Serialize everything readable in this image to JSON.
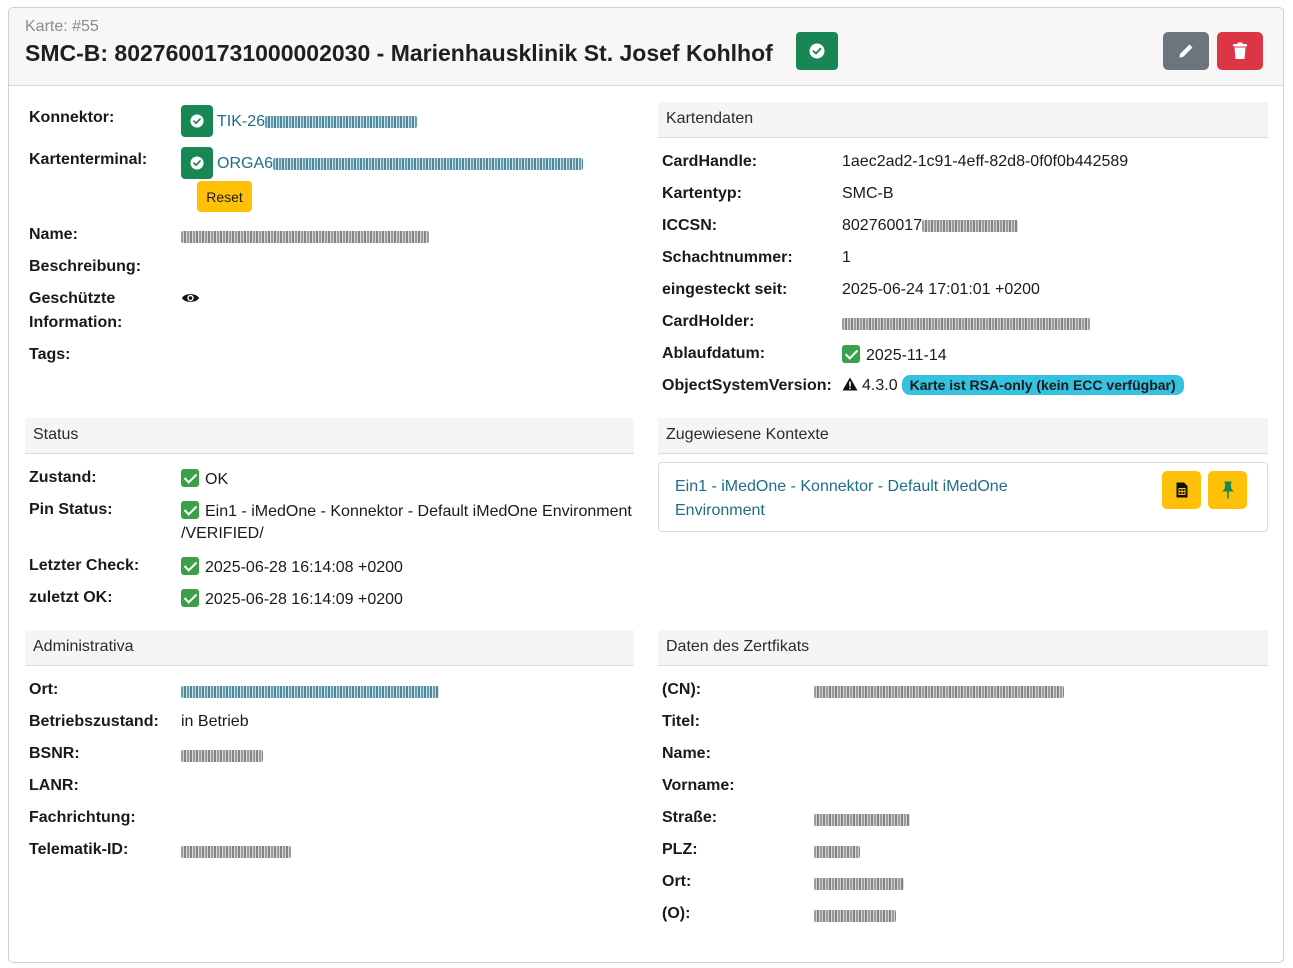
{
  "header": {
    "subtitle": "Karte: #55",
    "title": "SMC-B: 80276001731000002030 - Marienhausklinik St. Josef Kohlhof",
    "status_icon": "check-circle-icon",
    "edit_icon": "pencil-icon",
    "delete_icon": "trash-icon"
  },
  "left": {
    "konnektor_label": "Konnektor:",
    "konnektor_value": "TIK-26",
    "kartenterminal_label": "Kartenterminal:",
    "kartenterminal_value": "ORGA6",
    "reset_label": "Reset",
    "name_label": "Name:",
    "beschreibung_label": "Beschreibung:",
    "geschuetzte_label_1": "Geschützte",
    "geschuetzte_label_2": "Information:",
    "tags_label": "Tags:"
  },
  "kartendaten": {
    "heading": "Kartendaten",
    "rows": [
      {
        "label": "CardHandle:",
        "value": "1aec2ad2-1c91-4eff-82d8-0f0f0b442589"
      },
      {
        "label": "Kartentyp:",
        "value": "SMC-B"
      },
      {
        "label": "ICCSN:",
        "value": "802760017"
      },
      {
        "label": "Schachtnummer:",
        "value": "1"
      },
      {
        "label": "eingesteckt seit:",
        "value": "2025-06-24 17:01:01 +0200"
      },
      {
        "label": "CardHolder:",
        "value": ""
      },
      {
        "label": "Ablaufdatum:",
        "value": "2025-11-14"
      },
      {
        "label": "ObjectSystemVersion:",
        "value": "4.3.0"
      }
    ],
    "rsa_badge": "Karte ist RSA-only (kein ECC verfügbar)"
  },
  "status": {
    "heading": "Status",
    "zustand_label": "Zustand:",
    "zustand_value": "OK",
    "pin_label": "Pin Status:",
    "pin_value_1": "Ein1 - iMedOne - Konnektor - Default iMedOne Environment",
    "pin_value_2": "/VERIFIED/",
    "check_label": "Letzter Check:",
    "check_value": "2025-06-28 16:14:08 +0200",
    "ok_label": "zuletzt OK:",
    "ok_value": "2025-06-28 16:14:09 +0200"
  },
  "kontexte": {
    "heading": "Zugewiesene Kontexte",
    "link_1": "Ein1 - iMedOne - Konnektor - Default iMedOne",
    "link_2": "Environment"
  },
  "administrativa": {
    "heading": "Administrativa",
    "ort_label": "Ort:",
    "betrieb_label": "Betriebszustand:",
    "betrieb_value": "in Betrieb",
    "bsnr_label": "BSNR:",
    "lanr_label": "LANR:",
    "fach_label": "Fachrichtung:",
    "tid_label": "Telematik-ID:"
  },
  "zertifikat": {
    "heading": "Daten des Zertfikats",
    "cn_label": "(CN):",
    "titel_label": "Titel:",
    "name_label": "Name:",
    "vorname_label": "Vorname:",
    "strasse_label": "Straße:",
    "plz_label": "PLZ:",
    "ort_label": "Ort:",
    "o_label": "(O):"
  },
  "colors": {
    "success": "#198754",
    "danger": "#dc3545",
    "secondary": "#6c757d",
    "warning": "#ffc107",
    "info": "#35c2e0",
    "link": "#1d6e86"
  }
}
